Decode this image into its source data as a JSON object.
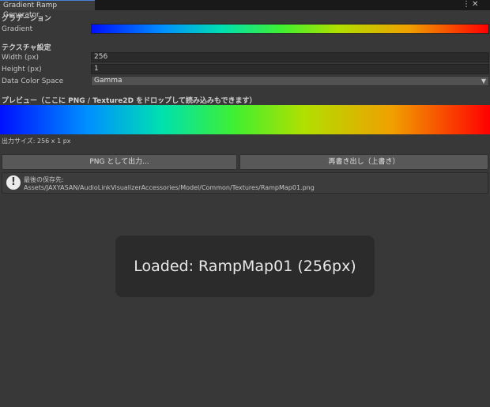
{
  "window": {
    "tab_title": "Gradient Ramp Generator",
    "menu_icon": "kebab-menu-icon",
    "close_icon": "close-icon"
  },
  "gradient_section": {
    "heading": "グラデーション",
    "gradient_label": "Gradient"
  },
  "texture_section": {
    "heading": "テクスチャ設定",
    "width_label": "Width (px)",
    "width_value": "256",
    "height_label": "Height (px)",
    "height_value": "1",
    "color_space_label": "Data Color Space",
    "color_space_value": "Gamma"
  },
  "preview_section": {
    "heading": "プレビュー（ここに PNG / Texture2D をドロップして読み込みもできます）",
    "output_size": "出力サイズ: 256 x 1 px"
  },
  "buttons": {
    "export_png": "PNG として出力...",
    "overwrite": "再書き出し（上書き）"
  },
  "help": {
    "icon": "info-exclamation-icon",
    "title": "最後の保存先:",
    "path": "Assets/JAXYASAN/AudioLinkVisualizerAccessories/Model/Common/Textures/RampMap01.png"
  },
  "toast": {
    "message": "Loaded: RampMap01 (256px)"
  }
}
